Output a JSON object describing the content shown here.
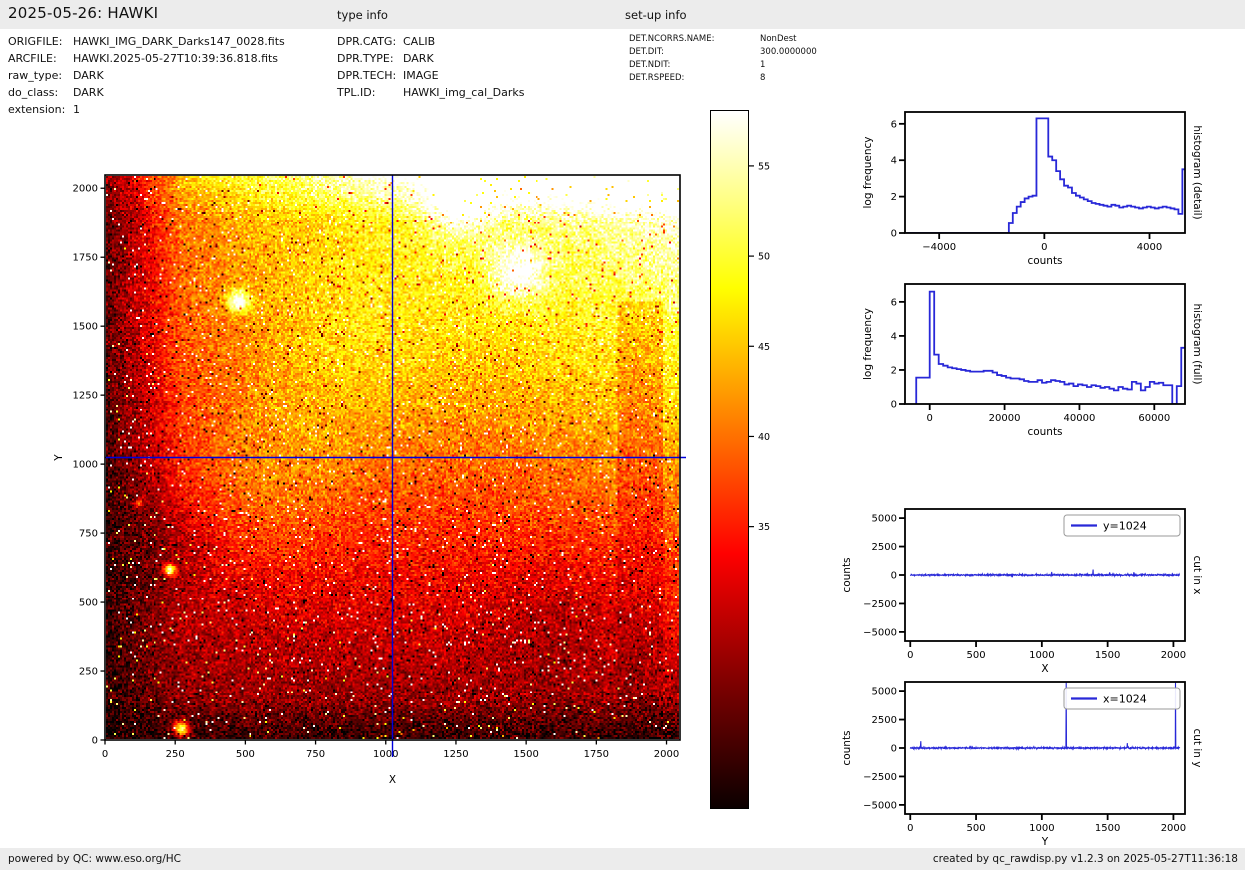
{
  "header": {
    "title": "2025-05-26: HAWKI",
    "type_info_heading": "type info",
    "setup_info_heading": "set-up info"
  },
  "file_info": {
    "rows": [
      {
        "label": "ORIGFILE:",
        "value": "HAWKI_IMG_DARK_Darks147_0028.fits"
      },
      {
        "label": "ARCFILE:",
        "value": "HAWKI.2025-05-27T10:39:36.818.fits"
      },
      {
        "label": "raw_type:",
        "value": "DARK"
      },
      {
        "label": "do_class:",
        "value": "DARK"
      },
      {
        "label": "extension:",
        "value": "1"
      }
    ]
  },
  "type_info": {
    "rows": [
      {
        "label": "DPR.CATG:",
        "value": "CALIB"
      },
      {
        "label": "DPR.TYPE:",
        "value": "DARK"
      },
      {
        "label": "DPR.TECH:",
        "value": "IMAGE"
      },
      {
        "label": "TPL.ID:",
        "value": "HAWKI_img_cal_Darks"
      }
    ]
  },
  "setup_info": {
    "rows": [
      {
        "label": "DET.NCORRS.NAME:",
        "value": "NonDest"
      },
      {
        "label": "DET.DIT:",
        "value": "300.0000000"
      },
      {
        "label": "DET.NDIT:",
        "value": "1"
      },
      {
        "label": "DET.RSPEED:",
        "value": "8"
      }
    ]
  },
  "footer": {
    "left": "powered by QC: www.eso.org/HC",
    "right": "created by qc_rawdisp.py v1.2.3 on 2025-05-27T11:36:18"
  },
  "colors": {
    "line_blue": "#2828d8",
    "crosshair_blue": "#0000dd",
    "bar_bg": "#ececec"
  },
  "chart_data": [
    {
      "id": "dark_frame",
      "type": "heatmap",
      "xlabel": "X",
      "ylabel": "Y",
      "xlim": [
        0,
        2048
      ],
      "ylim": [
        0,
        2048
      ],
      "xticks": [
        0,
        250,
        500,
        750,
        1000,
        1250,
        1500,
        1750,
        2000
      ],
      "yticks": [
        0,
        250,
        500,
        750,
        1000,
        1250,
        1500,
        1750,
        2000
      ],
      "colormap": "hot",
      "colorbar": {
        "ticks": [
          55,
          50,
          45,
          40,
          35
        ],
        "vmin": 19.4,
        "vmax": 58.1
      },
      "crosshair": {
        "x": 1024,
        "y": 1024
      },
      "description": "2048x2048 raw dark frame, dark lower-left and edges, saturated bright upper-right"
    },
    {
      "id": "hist_detail",
      "type": "histogram-step",
      "side_label": "histogram (detail)",
      "xlabel": "counts",
      "ylabel": "log frequency",
      "xlim": [
        -5300,
        5350
      ],
      "ylim": [
        0,
        6.65
      ],
      "xticks": [
        -4000,
        0,
        4000
      ],
      "yticks": [
        0,
        2,
        4,
        6
      ],
      "bin_start": -5250,
      "bin_width": 150,
      "values": [
        0,
        0,
        0,
        0,
        0,
        0,
        0,
        0,
        0,
        0,
        0,
        0,
        0,
        0,
        0,
        0,
        0,
        0,
        0,
        0,
        0,
        0,
        0,
        0,
        0,
        0,
        0.55,
        1.1,
        1.45,
        1.7,
        1.9,
        2.0,
        2.05,
        6.3,
        6.3,
        6.3,
        4.2,
        4.0,
        3.4,
        2.95,
        2.6,
        2.5,
        2.2,
        2.05,
        1.95,
        1.85,
        1.75,
        1.65,
        1.6,
        1.55,
        1.5,
        1.45,
        1.55,
        1.5,
        1.4,
        1.45,
        1.5,
        1.45,
        1.4,
        1.35,
        1.4,
        1.45,
        1.4,
        1.35,
        1.4,
        1.45,
        1.4,
        1.35,
        1.3,
        1.05,
        3.5
      ]
    },
    {
      "id": "hist_full",
      "type": "histogram-step",
      "side_label": "histogram (full)",
      "xlabel": "counts",
      "ylabel": "log frequency",
      "xlim": [
        -6600,
        68200
      ],
      "ylim": [
        0,
        7.05
      ],
      "xticks": [
        0,
        20000,
        40000,
        60000
      ],
      "yticks": [
        0,
        2,
        4,
        6
      ],
      "bin_start": -3600,
      "bin_width": 1200,
      "values": [
        1.55,
        1.55,
        1.55,
        6.6,
        2.9,
        2.35,
        2.25,
        2.15,
        2.1,
        2.05,
        2.0,
        1.95,
        1.9,
        1.9,
        1.9,
        1.95,
        1.95,
        1.85,
        1.7,
        1.65,
        1.55,
        1.5,
        1.5,
        1.45,
        1.35,
        1.3,
        1.3,
        1.4,
        1.25,
        1.3,
        1.4,
        1.35,
        1.3,
        1.15,
        1.2,
        1.05,
        1.15,
        1.1,
        1.0,
        1.1,
        1.05,
        0.95,
        1.0,
        0.9,
        0.8,
        1.0,
        0.9,
        0.85,
        1.3,
        1.2,
        0.8,
        1.0,
        1.3,
        1.2,
        1.25,
        1.1,
        1.1,
        0,
        1.05,
        3.3
      ]
    },
    {
      "id": "cut_x",
      "type": "noisy-line",
      "legend": "y=1024",
      "side_label": "cut in x",
      "xlabel": "X",
      "ylabel": "counts",
      "xlim": [
        -40,
        2088
      ],
      "ylim": [
        -5800,
        5800
      ],
      "xticks": [
        0,
        500,
        1000,
        1500,
        2000
      ],
      "yticks": [
        5000,
        2500,
        0,
        -2500,
        -5000
      ],
      "x_max": 2048,
      "n_points": 1024,
      "noise_amp": 55,
      "spikes": [
        {
          "x": 1075,
          "v": 270
        },
        {
          "x": 1390,
          "v": 480
        },
        {
          "x": 1515,
          "v": 240
        },
        {
          "x": 1700,
          "v": 250
        }
      ]
    },
    {
      "id": "cut_y",
      "type": "noisy-line",
      "legend": "x=1024",
      "side_label": "cut in y",
      "xlabel": "Y",
      "ylabel": "counts",
      "xlim": [
        -40,
        2088
      ],
      "ylim": [
        -5800,
        5800
      ],
      "xticks": [
        0,
        500,
        1000,
        1500,
        2000
      ],
      "yticks": [
        5000,
        2500,
        0,
        -2500,
        -5000
      ],
      "x_max": 2048,
      "n_points": 1024,
      "noise_amp": 55,
      "spikes": [
        {
          "x": 80,
          "v": 600
        },
        {
          "x": 460,
          "v": 190
        },
        {
          "x": 1185,
          "v": 9000
        },
        {
          "x": 1650,
          "v": 430
        },
        {
          "x": 2015,
          "v": 9000
        }
      ]
    }
  ]
}
